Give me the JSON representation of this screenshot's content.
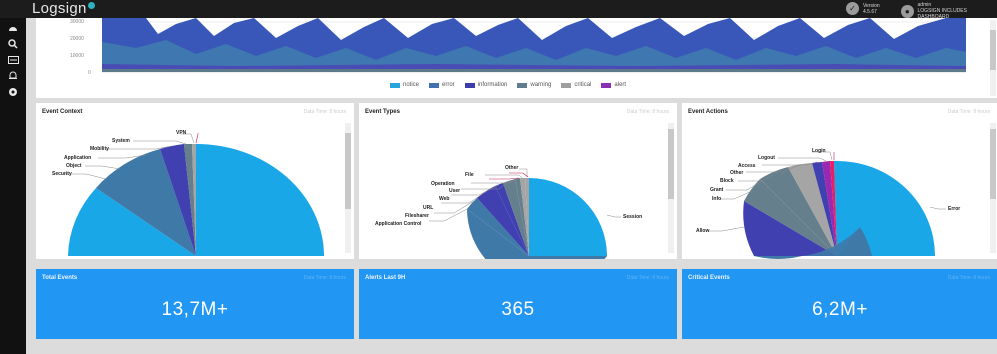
{
  "app": {
    "logo_text": "Logsign"
  },
  "topbar": {
    "version_label": "Version",
    "version_value": "4.5.67",
    "user_label": "admin",
    "user_value": "LOGSIGN INCLUDES DASHBOARD"
  },
  "sidebar": {
    "items": [
      {
        "icon": "dashboard-icon"
      },
      {
        "icon": "search-icon"
      },
      {
        "icon": "reports-icon"
      },
      {
        "icon": "bell-icon"
      },
      {
        "icon": "settings-icon"
      }
    ]
  },
  "area_chart": {
    "y_ticks": [
      "30000",
      "20000",
      "10000",
      "0"
    ],
    "legend": [
      {
        "label": "notice",
        "color": "#29a3de"
      },
      {
        "label": "error",
        "color": "#3f72af"
      },
      {
        "label": "information",
        "color": "#3c3cad"
      },
      {
        "label": "warning",
        "color": "#5f7d8c"
      },
      {
        "label": "critical",
        "color": "#9e9e9e"
      },
      {
        "label": "alert",
        "color": "#8b2fb7"
      }
    ]
  },
  "panels": {
    "event_context": {
      "title": "Event Context",
      "subtitle": "Data Time: 8 hours",
      "labels": [
        "VPN",
        "System",
        "Mobility",
        "Application",
        "Object",
        "Security"
      ]
    },
    "event_types": {
      "title": "Event Types",
      "subtitle": "Data Time: 8 hours",
      "labels": [
        "Other",
        "File",
        "Operation",
        "User",
        "Web",
        "URL",
        "Filesharer",
        "Application Control",
        "Session"
      ]
    },
    "event_actions": {
      "title": "Event Actions",
      "subtitle": "Data Time: 8 hours",
      "labels": [
        "Login",
        "Logout",
        "Access",
        "Other",
        "Block",
        "Grant",
        "Info",
        "Allow",
        "Error"
      ]
    }
  },
  "kpis": [
    {
      "title": "Total Events",
      "subtitle": "Data Time: 8 hours",
      "value": "13,7M+"
    },
    {
      "title": "Alerts Last 9H",
      "subtitle": "Data Time: 8 hours",
      "value": "365"
    },
    {
      "title": "Critical Events",
      "subtitle": "Data Time: 8 hours",
      "value": "6,2M+"
    }
  ],
  "colors": {
    "kpi_blue": "#2196f3",
    "pie_cyan": "#1aa7e8",
    "pie_steel": "#3f79a8",
    "pie_indigo": "#4040b0",
    "pie_slate": "#667f8c",
    "pie_gray": "#a5a5a5",
    "pie_purple": "#9c27b0",
    "pie_magenta": "#e91e63"
  }
}
